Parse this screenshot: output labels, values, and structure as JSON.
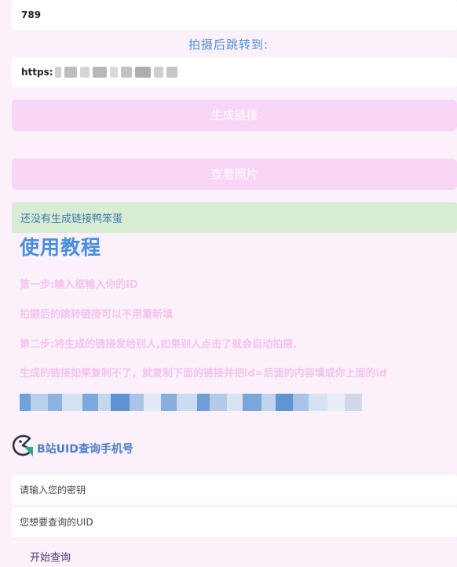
{
  "id_field": {
    "value": "789"
  },
  "redirect": {
    "label": "拍摄后跳转到:",
    "url_prefix": "https:"
  },
  "buttons": {
    "generate_link": "生成链接",
    "view_photos": "查看照片"
  },
  "notice": "还没有生成链接鸭笨蛋",
  "tutorial": {
    "title": "使用教程",
    "steps": [
      "第一步:输入框输入你的ID",
      "拍摄后的跳转链接可以不用重新填",
      "第二步:将生成的链接发给别人,如果别人点击了就会自动拍摄.",
      "生成的链接如果复制不了，就复制下面的链接并把id=后面的内容填成你上面的id"
    ]
  },
  "uid_query": {
    "title": "B站UID查询手机号",
    "key_placeholder": "请输入您的密钥",
    "uid_placeholder": "您想要查询的UID",
    "start_label": "开始查询"
  },
  "colors": {
    "page_bg": "#fbf1fb",
    "accent_blue": "#4a8ee0",
    "button_pink": "#f9d6f5",
    "notice_green": "#d9ecd4",
    "step_pink": "#f4c4ec"
  },
  "icons": {
    "logo": "pacman-logo-icon"
  }
}
